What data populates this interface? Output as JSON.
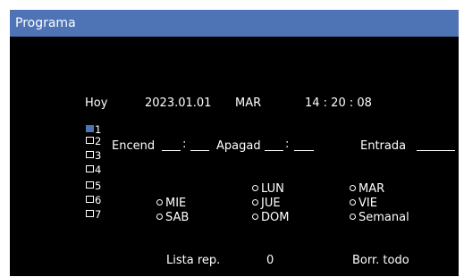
{
  "window": {
    "title": "Programa"
  },
  "status": {
    "today_label": "Hoy",
    "date": "2023.01.01",
    "weekday": "MAR",
    "time": "14 : 20 : 08"
  },
  "slots": [
    "1",
    "2",
    "3",
    "4",
    "5",
    "6",
    "7"
  ],
  "form": {
    "on_label": "Encend",
    "off_label": "Apagad",
    "colon": ":",
    "input_label": "Entrada"
  },
  "days": {
    "lun": "LUN",
    "mar": "MAR",
    "mie": "MIE",
    "jue": "JUE",
    "vie": "VIE",
    "sab": "SAB",
    "dom": "DOM",
    "semanal": "Semanal"
  },
  "footer": {
    "playlist_label": "Lista rep.",
    "playlist_value": "0",
    "clear_all_label": "Borr. todo"
  },
  "colors": {
    "titlebar": "#4f74b6",
    "background": "#000000",
    "text": "#ffffff"
  }
}
